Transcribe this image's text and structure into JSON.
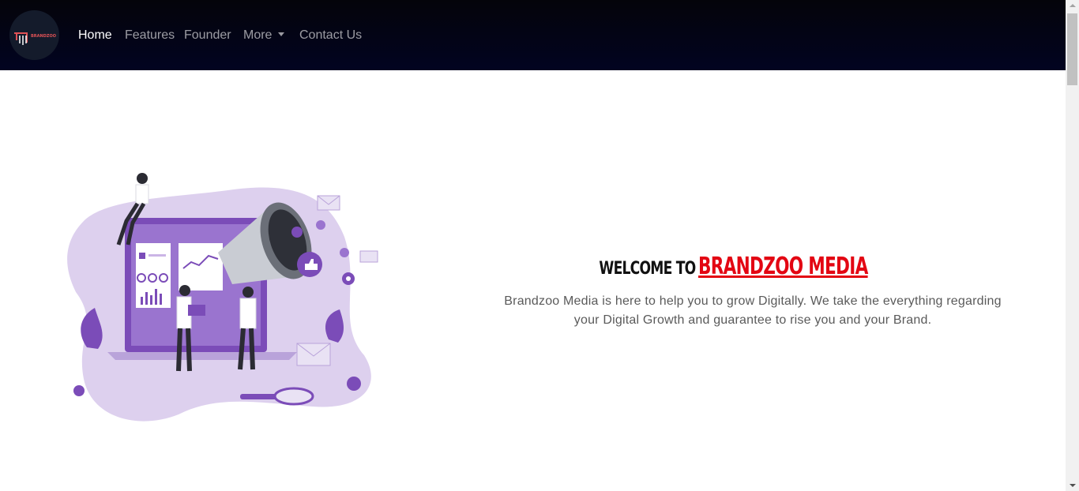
{
  "navbar": {
    "logo_text": "BRANDZOO",
    "links": [
      {
        "label": "Home",
        "active": true
      },
      {
        "label": "Features",
        "active": false
      },
      {
        "label": "Founder",
        "active": false
      },
      {
        "label": "More",
        "active": false,
        "dropdown": true
      },
      {
        "label": "Contact Us",
        "active": false
      }
    ]
  },
  "hero": {
    "welcome_prefix": "Welcome to",
    "brand_name": "BRANDZOO MEDIA",
    "description": "Brandzoo Media is here to help you to grow Digitally. We take the everything regarding your Digital Growth and guarantee to rise you and your Brand."
  },
  "colors": {
    "nav_background": "#020421",
    "brand_red": "#e30613",
    "illustration_purple": "#7b4cb8"
  },
  "icons": [
    "megaphone-icon",
    "thumbs-up-icon",
    "gear-icon",
    "magnifier-icon",
    "envelope-icon"
  ]
}
